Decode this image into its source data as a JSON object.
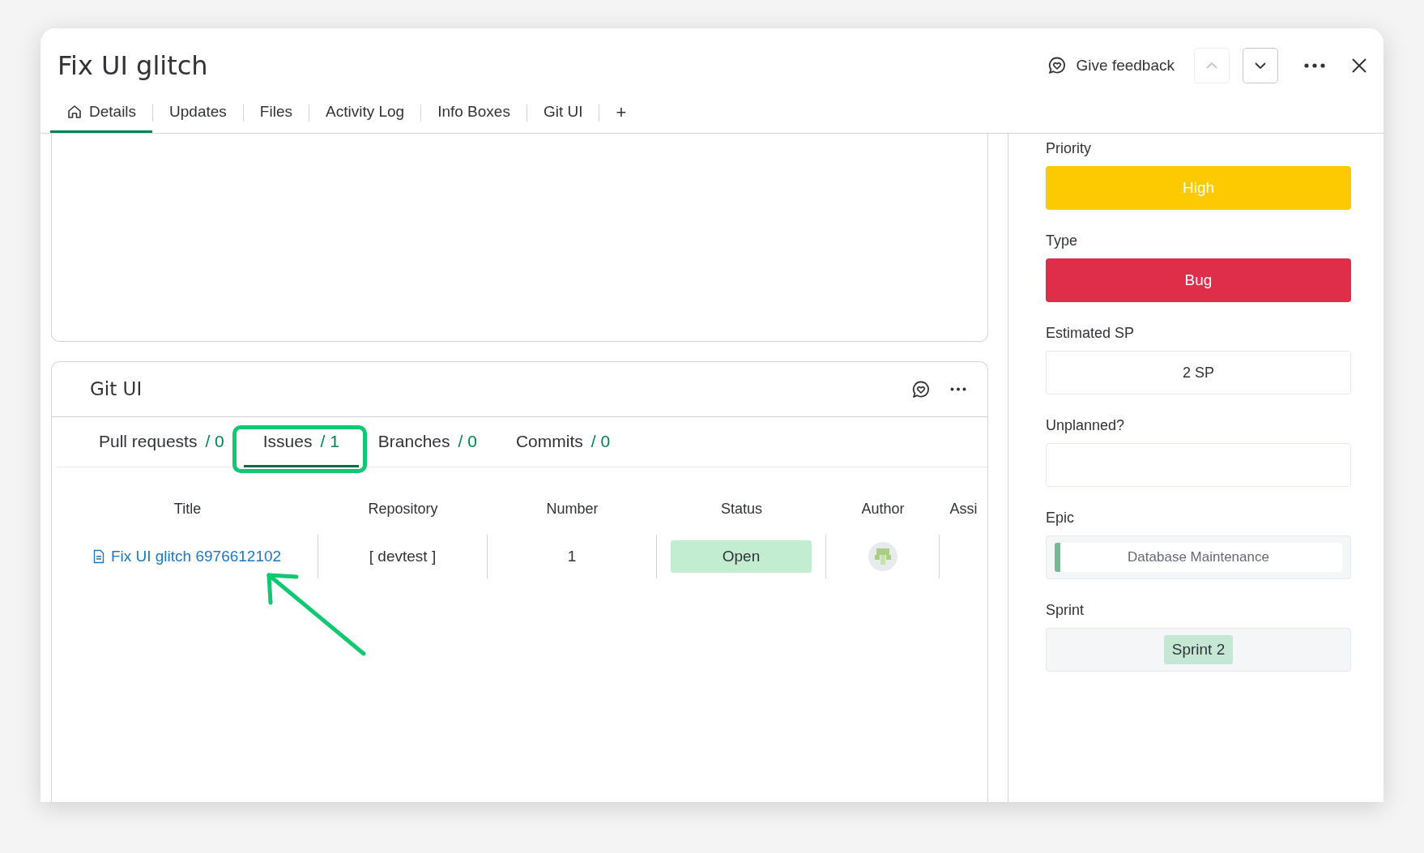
{
  "window": {
    "title": "Fix UI glitch"
  },
  "header_actions": {
    "feedback": "Give feedback",
    "prev_disabled": true,
    "next_disabled": false
  },
  "tabs": [
    {
      "label": "Details",
      "selected": true
    },
    {
      "label": "Updates",
      "selected": false
    },
    {
      "label": "Files",
      "selected": false
    },
    {
      "label": "Activity Log",
      "selected": false
    },
    {
      "label": "Info Boxes",
      "selected": false
    },
    {
      "label": "Git UI",
      "selected": false
    }
  ],
  "add_tab": "+",
  "git_ui": {
    "title": "Git UI",
    "tabs": [
      {
        "label": "Pull requests",
        "count": "/ 0",
        "selected": false,
        "annotated": false
      },
      {
        "label": "Issues",
        "count": "/ 1",
        "selected": true,
        "annotated": true
      },
      {
        "label": "Branches",
        "count": "/ 0",
        "selected": false,
        "annotated": false
      },
      {
        "label": "Commits",
        "count": "/ 0",
        "selected": false,
        "annotated": false
      }
    ],
    "columns": [
      "Title",
      "Repository",
      "Number",
      "Status",
      "Author",
      "Assi"
    ],
    "rows": [
      {
        "title": "Fix UI glitch 6976612102",
        "repository": "[ devtest ]",
        "number": "1",
        "status": {
          "label": "Open",
          "color": "#c3edd1"
        },
        "annotated": true
      }
    ]
  },
  "fields": [
    {
      "label": "Priority",
      "kind": "status",
      "value": "High",
      "color": "#fdc900"
    },
    {
      "label": "Type",
      "kind": "status",
      "value": "Bug",
      "color": "#df2e4a"
    },
    {
      "label": "Estimated SP",
      "kind": "text",
      "value": "2 SP"
    },
    {
      "label": "Unplanned?",
      "kind": "text"
    },
    {
      "label": "Epic",
      "kind": "epic",
      "value": "Database Maintenance",
      "color": "#7ab893"
    },
    {
      "label": "Sprint",
      "kind": "tag",
      "value": "Sprint 2"
    }
  ]
}
